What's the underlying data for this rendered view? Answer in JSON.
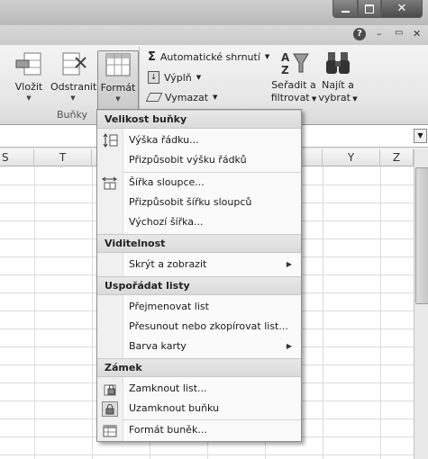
{
  "window": {
    "minimize_icon": "minimize-icon",
    "maximize_icon": "restore-icon",
    "close_icon": "close-icon"
  },
  "ribbon_top": {
    "help": "?",
    "min": "–",
    "restore": "▭",
    "close": "✕"
  },
  "ribbon": {
    "cells_group": {
      "label": "Buňky",
      "insert": "Vložit",
      "delete": "Odstranit",
      "format": "Formát"
    },
    "editing": {
      "autosum": "Automatické shrnutí",
      "fill": "Výplň",
      "clear": "Vymazat",
      "sort_line1": "Seřadit a",
      "sort_line2": "filtrovat",
      "find_line1": "Najít a",
      "find_line2": "vybrat"
    }
  },
  "sheet": {
    "columns": [
      "S",
      "T",
      "",
      "",
      "",
      "Y",
      "Z"
    ]
  },
  "menu": {
    "sections": [
      {
        "title": "Velikost buňky",
        "items": [
          {
            "label": "Výška řádku...",
            "icon": "row-height-icon"
          },
          {
            "label": "Přizpůsobit výšku řádků",
            "icon": ""
          },
          {
            "label": "Šířka sloupce...",
            "icon": "column-width-icon"
          },
          {
            "label": "Přizpůsobit šířku sloupců",
            "icon": ""
          },
          {
            "label": "Výchozí šířka...",
            "icon": ""
          }
        ]
      },
      {
        "title": "Viditelnost",
        "items": [
          {
            "label": "Skrýt a zobrazit",
            "icon": "",
            "submenu": true
          }
        ]
      },
      {
        "title": "Uspořádat listy",
        "items": [
          {
            "label": "Přejmenovat list",
            "icon": ""
          },
          {
            "label": "Přesunout nebo zkopírovat list...",
            "icon": ""
          },
          {
            "label": "Barva karty",
            "icon": "",
            "submenu": true
          }
        ]
      },
      {
        "title": "Zámek",
        "items": [
          {
            "label": "Zamknout list...",
            "icon": "protect-sheet-icon"
          },
          {
            "label": "Uzamknout buňku",
            "icon": "lock-cell-icon"
          },
          {
            "label": "Formát buněk...",
            "icon": "format-cells-icon"
          }
        ]
      }
    ]
  }
}
